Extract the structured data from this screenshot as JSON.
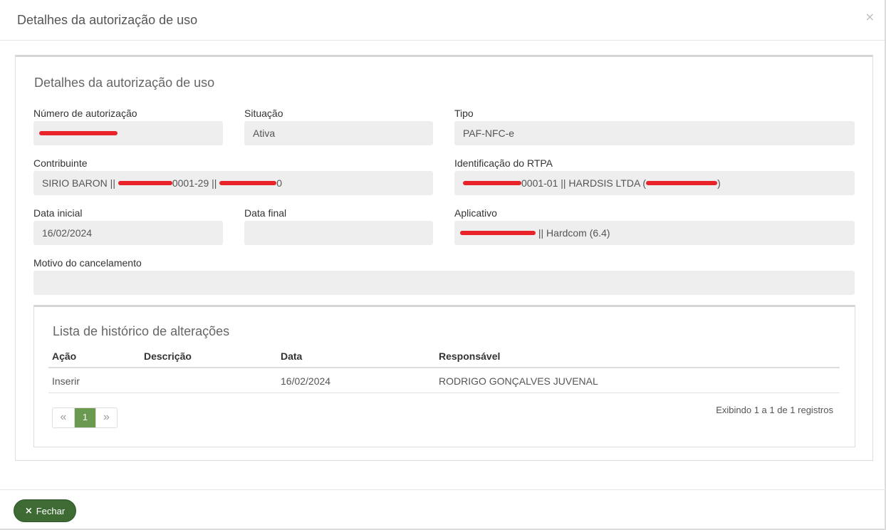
{
  "modal": {
    "title": "Detalhes da autorização de uso",
    "close_symbol": "×"
  },
  "panel": {
    "title": "Detalhes da autorização de uso"
  },
  "fields": {
    "numero": {
      "label": "Número de autorização",
      "value": ""
    },
    "situacao": {
      "label": "Situação",
      "value": "Ativa"
    },
    "tipo": {
      "label": "Tipo",
      "value": "PAF-NFC-e"
    },
    "contribuinte": {
      "label": "Contribuinte",
      "value_a": "SIRIO BARON || ",
      "value_b": "0001-29 || ",
      "value_c": "0"
    },
    "rtpa": {
      "label": "Identificação do RTPA",
      "value_a": "0001-01 || HARDSIS LTDA (",
      "value_b": ")"
    },
    "data_inicial": {
      "label": "Data inicial",
      "value": "16/02/2024"
    },
    "data_final": {
      "label": "Data final",
      "value": ""
    },
    "aplicativo": {
      "label": "Aplicativo",
      "value_a": " || Hardcom (6.4)"
    },
    "motivo": {
      "label": "Motivo do cancelamento",
      "value": ""
    }
  },
  "history": {
    "title": "Lista de histórico de alterações",
    "columns": [
      "Ação",
      "Descrição",
      "Data",
      "Responsável"
    ],
    "rows": [
      {
        "acao": "Inserir",
        "descricao": "",
        "data": "16/02/2024",
        "responsavel": "RODRIGO GONÇALVES JUVENAL"
      }
    ],
    "pagination": {
      "prev": "«",
      "current": "1",
      "next": "»"
    },
    "records_info": "Exibindo 1 a 1 de 1 registros"
  },
  "footer": {
    "close_label": "Fechar",
    "close_icon": "×"
  },
  "colors": {
    "redaction": "#e8232a",
    "primary_button": "#3d6b33",
    "active_page": "#6a9a4f"
  }
}
